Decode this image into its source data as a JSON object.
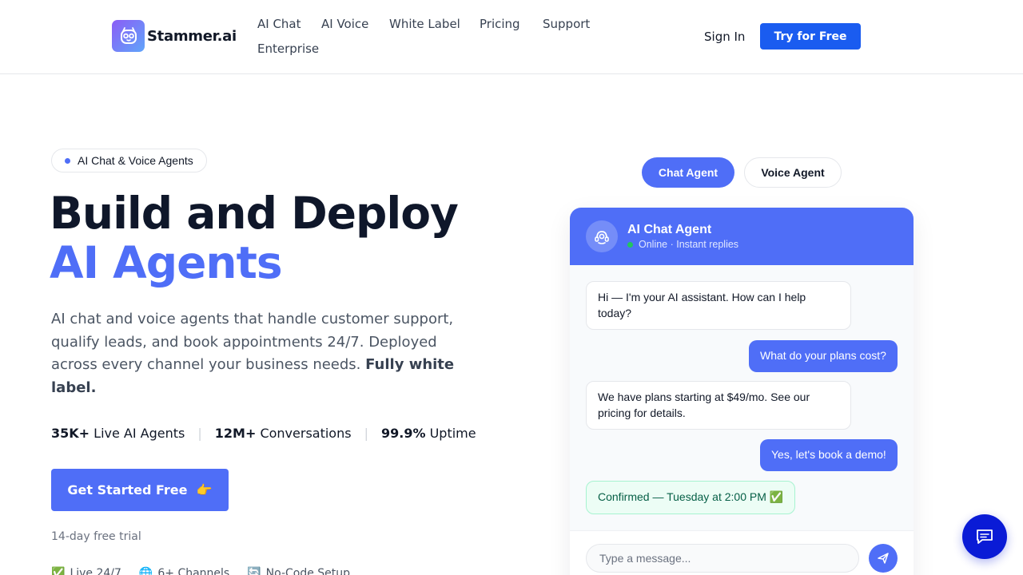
{
  "header": {
    "logo_text": "Stammer.ai",
    "nav": [
      {
        "label": "AI Chat"
      },
      {
        "label": "AI Voice"
      },
      {
        "label": "White Label"
      },
      {
        "label": "Pricing"
      },
      {
        "label": "Support"
      },
      {
        "label": "Enterprise"
      }
    ],
    "signin_label": "Sign In",
    "try_label": "Try for Free"
  },
  "hero": {
    "badge": "AI Chat & Voice Agents",
    "title_line1": "Build and Deploy",
    "title_line2": "AI Agents",
    "lead": "AI chat and voice agents that handle customer support, qualify leads, and book appointments 24/7. Deployed across every channel your business needs.",
    "lead_bold": "Fully white label.",
    "stats": [
      {
        "value": "35K+",
        "label": "Live AI Agents"
      },
      {
        "value": "12M+",
        "label": "Conversations"
      },
      {
        "value": "99.9%",
        "label": "Uptime"
      }
    ],
    "cta_label": "Get Started Free",
    "cta_emoji": "👉",
    "trial_note": "14-day free trial",
    "features": [
      {
        "icon": "✅",
        "label": "Live 24/7"
      },
      {
        "icon": "🌐",
        "label": "6+ Channels"
      },
      {
        "icon": "🔄",
        "label": "No-Code Setup"
      }
    ]
  },
  "demo": {
    "tabs": [
      {
        "label": "Chat Agent",
        "active": true
      },
      {
        "label": "Voice Agent",
        "active": false
      }
    ],
    "agent_name": "AI Chat Agent",
    "agent_status": "Online · Instant replies",
    "messages": [
      {
        "from": "bot",
        "text": "Hi — I'm your AI assistant. How can I help today?"
      },
      {
        "from": "user",
        "text": "What do your plans cost?"
      },
      {
        "from": "bot",
        "text": "We have plans starting at $49/mo. See our pricing for details."
      },
      {
        "from": "user",
        "text": "Yes, let's book a demo!"
      },
      {
        "from": "confirm",
        "text": "Confirmed — Tuesday at 2:00 PM ✅"
      }
    ],
    "input_placeholder": "Type a message..."
  },
  "colors": {
    "accent": "#4f6ef7",
    "primary_button": "#1a5cf0",
    "floating_button": "#0a1bd6",
    "online": "#22c55e"
  }
}
